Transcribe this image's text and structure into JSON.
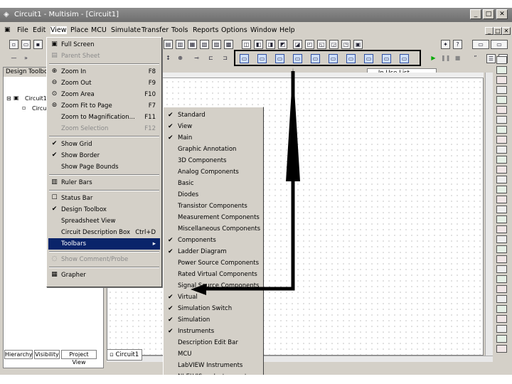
{
  "window": {
    "title": "Circuit1 - Multisim - [Circuit1]",
    "minimize": "_",
    "maximize": "□",
    "close": "✕"
  },
  "menubar": [
    "File",
    "Edit",
    "View",
    "Place",
    "MCU",
    "Simulate",
    "Transfer",
    "Tools",
    "Reports",
    "Options",
    "Window",
    "Help"
  ],
  "in_use_list": "--- In Use List ---",
  "toolbox": {
    "title": "Design Toolbox",
    "tree_root": "Circuit1",
    "tree_child": "Circuit1",
    "tabs": [
      "Hierarchy",
      "Visibility",
      "Project View"
    ]
  },
  "sheet_tab": "Circuit1",
  "view_menu": [
    {
      "label": "Full Screen",
      "shortcut": "",
      "icon": "fullscreen-icon",
      "glyph": "▣",
      "state": "normal"
    },
    {
      "label": "Parent Sheet",
      "shortcut": "",
      "icon": "parent-sheet-icon",
      "glyph": "▤",
      "state": "disabled"
    },
    {
      "sep": true
    },
    {
      "label": "Zoom In",
      "shortcut": "F8",
      "icon": "zoom-in-icon",
      "glyph": "⊕",
      "state": "normal"
    },
    {
      "label": "Zoom Out",
      "shortcut": "F9",
      "icon": "zoom-out-icon",
      "glyph": "⊖",
      "state": "normal"
    },
    {
      "label": "Zoom Area",
      "shortcut": "F10",
      "icon": "zoom-area-icon",
      "glyph": "⊙",
      "state": "normal"
    },
    {
      "label": "Zoom Fit to Page",
      "shortcut": "F7",
      "icon": "zoom-fit-icon",
      "glyph": "⊚",
      "state": "normal"
    },
    {
      "label": "Zoom to Magnification...",
      "shortcut": "F11",
      "icon": "",
      "glyph": "",
      "state": "normal"
    },
    {
      "label": "Zoom Selection",
      "shortcut": "F12",
      "icon": "",
      "glyph": "",
      "state": "disabled"
    },
    {
      "sep": true
    },
    {
      "label": "Show Grid",
      "shortcut": "",
      "icon": "check-icon",
      "glyph": "✔",
      "state": "normal"
    },
    {
      "label": "Show Border",
      "shortcut": "",
      "icon": "check-icon",
      "glyph": "✔",
      "state": "normal"
    },
    {
      "label": "Show Page Bounds",
      "shortcut": "",
      "icon": "",
      "glyph": "",
      "state": "normal"
    },
    {
      "sep": true
    },
    {
      "label": "Ruler Bars",
      "shortcut": "",
      "icon": "ruler-icon",
      "glyph": "▥",
      "state": "normal"
    },
    {
      "sep": true
    },
    {
      "label": "Status Bar",
      "shortcut": "",
      "icon": "statusbar-icon",
      "glyph": "☐",
      "state": "normal"
    },
    {
      "label": "Design Toolbox",
      "shortcut": "",
      "icon": "check-icon",
      "glyph": "✔",
      "state": "normal"
    },
    {
      "label": "Spreadsheet View",
      "shortcut": "",
      "icon": "",
      "glyph": "",
      "state": "normal"
    },
    {
      "label": "Circuit Description Box",
      "shortcut": "Ctrl+D",
      "icon": "",
      "glyph": "",
      "state": "normal"
    },
    {
      "label": "Toolbars",
      "shortcut": "▸",
      "icon": "",
      "glyph": "",
      "state": "selected"
    },
    {
      "sep": true
    },
    {
      "label": "Show Comment/Probe",
      "shortcut": "",
      "icon": "comment-icon",
      "glyph": "◌",
      "state": "disabled"
    },
    {
      "sep": true
    },
    {
      "label": "Grapher",
      "shortcut": "",
      "icon": "grapher-icon",
      "glyph": "▦",
      "state": "normal"
    }
  ],
  "toolbars_submenu": [
    {
      "label": "Standard",
      "checked": true
    },
    {
      "label": "View",
      "checked": true
    },
    {
      "label": "Main",
      "checked": true
    },
    {
      "label": "Graphic Annotation",
      "checked": false
    },
    {
      "label": "3D Components",
      "checked": false
    },
    {
      "label": "Analog Components",
      "checked": false
    },
    {
      "label": "Basic",
      "checked": false
    },
    {
      "label": "Diodes",
      "checked": false
    },
    {
      "label": "Transistor Components",
      "checked": false
    },
    {
      "label": "Measurement Components",
      "checked": false
    },
    {
      "label": "Miscellaneous Components",
      "checked": false
    },
    {
      "label": "Components",
      "checked": true
    },
    {
      "label": "Ladder Diagram",
      "checked": true
    },
    {
      "label": "Power Source Components",
      "checked": false
    },
    {
      "label": "Rated Virtual Components",
      "checked": false
    },
    {
      "label": "Signal Source Components",
      "checked": false
    },
    {
      "label": "Virtual",
      "checked": true
    },
    {
      "label": "Simulation Switch",
      "checked": true
    },
    {
      "label": "Simulation",
      "checked": true
    },
    {
      "label": "Instruments",
      "checked": true
    },
    {
      "label": "Description Edit Bar",
      "checked": false
    },
    {
      "label": "MCU",
      "checked": false
    },
    {
      "label": "LabVIEW Instruments",
      "checked": false
    },
    {
      "label": "NI ELVISmx Instruments",
      "checked": false
    }
  ]
}
